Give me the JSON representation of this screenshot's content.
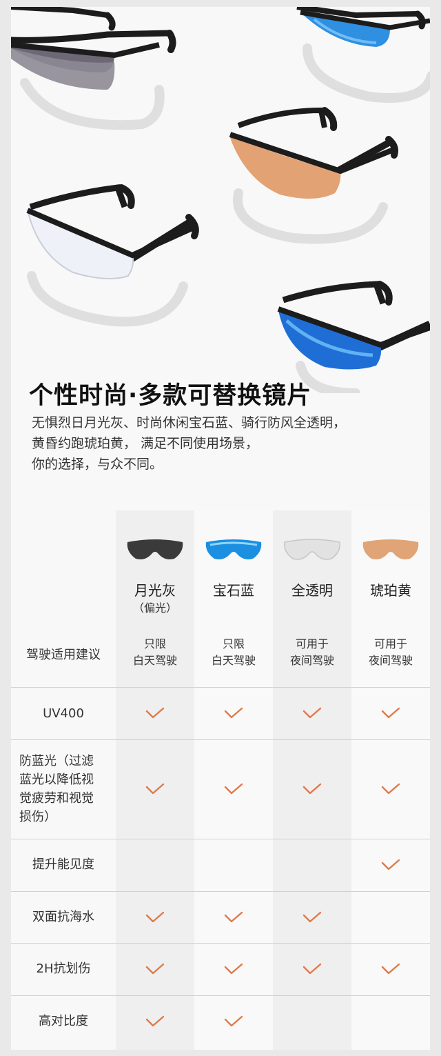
{
  "headline": "个性时尚·多款可替换镜片",
  "description": [
    "无惧烈日月光灰、时尚休闲宝石蓝、骑行防风全透明，",
    "黄昏约跑琥珀黄， 满足不同使用场景，",
    "你的选择，与众不同。"
  ],
  "columns": [
    {
      "name": "月光灰",
      "sub": "（偏光）",
      "drive": [
        "只限",
        "白天驾驶"
      ],
      "lens_color": "#3a3a3a"
    },
    {
      "name": "宝石蓝",
      "sub": "",
      "drive": [
        "只限",
        "白天驾驶"
      ],
      "lens_color": "#1c8fe0"
    },
    {
      "name": "全透明",
      "sub": "",
      "drive": [
        "可用于",
        "夜间驾驶"
      ],
      "lens_color": "#dcdcdc"
    },
    {
      "name": "琥珀黄",
      "sub": "",
      "drive": [
        "可用于",
        "夜间驾驶"
      ],
      "lens_color": "#e0a476"
    }
  ],
  "drive_row_label": "驾驶适用建议",
  "rows": [
    {
      "label": [
        "UV400"
      ],
      "checks": [
        true,
        true,
        true,
        true
      ]
    },
    {
      "label": [
        "防蓝光（过滤",
        "蓝光以降低视",
        "觉疲劳和视觉",
        "损伤）"
      ],
      "checks": [
        true,
        true,
        true,
        true
      ]
    },
    {
      "label": [
        "提升能见度"
      ],
      "checks": [
        false,
        false,
        false,
        true
      ]
    },
    {
      "label": [
        "双面抗海水"
      ],
      "checks": [
        true,
        true,
        true,
        false
      ]
    },
    {
      "label": [
        "2H抗划伤"
      ],
      "checks": [
        true,
        true,
        true,
        true
      ]
    },
    {
      "label": [
        "高对比度"
      ],
      "checks": [
        true,
        true,
        false,
        false
      ]
    }
  ],
  "colors": {
    "check": "#e07a4a",
    "frame": "#1c1c1c"
  }
}
